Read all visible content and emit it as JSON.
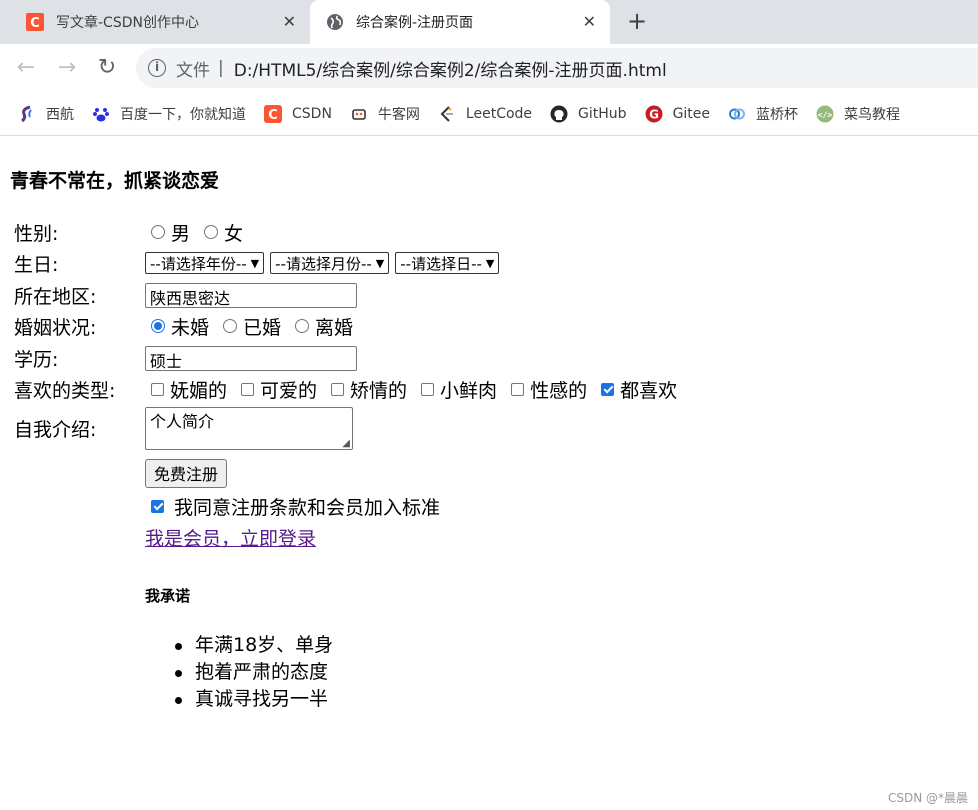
{
  "browser": {
    "tabs": [
      {
        "title": "写文章-CSDN创作中心",
        "icon": "csdn-icon"
      },
      {
        "title": "综合案例-注册页面",
        "icon": "globe-icon"
      }
    ],
    "new_tab": "+",
    "url_scheme": "文件",
    "url": "D:/HTML5/综合案例/综合案例2/综合案例-注册页面.html",
    "bookmarks": [
      {
        "label": "西航",
        "icon": "xihang-icon",
        "color": "#5b3a8e"
      },
      {
        "label": "百度一下，你就知道",
        "icon": "baidu-icon",
        "color": "#2932e1"
      },
      {
        "label": "CSDN",
        "icon": "csdn-icon",
        "color": "#fc5531"
      },
      {
        "label": "牛客网",
        "icon": "nowcoder-icon",
        "color": "#333333"
      },
      {
        "label": "LeetCode",
        "icon": "leetcode-icon",
        "color": "#ffa116"
      },
      {
        "label": "GitHub",
        "icon": "github-icon",
        "color": "#24292e"
      },
      {
        "label": "Gitee",
        "icon": "gitee-icon",
        "color": "#c71d23"
      },
      {
        "label": "蓝桥杯",
        "icon": "lanqiao-icon",
        "color": "#2a7fd4"
      },
      {
        "label": "菜鸟教程",
        "icon": "runoob-icon",
        "color": "#96b97d"
      }
    ]
  },
  "page": {
    "heading": "青春不常在，抓紧谈恋爱",
    "gender": {
      "label": "性别:",
      "options": [
        "男",
        "女"
      ]
    },
    "birthday": {
      "label": "生日:",
      "year": "--请选择年份--",
      "month": "--请选择月份--",
      "day": "--请选择日--"
    },
    "region": {
      "label": "所在地区:",
      "value": "陕西思密达"
    },
    "marital": {
      "label": "婚姻状况:",
      "options": [
        "未婚",
        "已婚",
        "离婚"
      ],
      "selected": "未婚"
    },
    "education": {
      "label": "学历:",
      "value": "硕士"
    },
    "types": {
      "label": "喜欢的类型:",
      "options": [
        "妩媚的",
        "可爱的",
        "矫情的",
        "小鲜肉",
        "性感的",
        "都喜欢"
      ],
      "checked": [
        "都喜欢"
      ]
    },
    "intro": {
      "label": "自我介绍:",
      "value": "个人简介"
    },
    "submit": "免费注册",
    "agree": "我同意注册条款和会员加入标准",
    "login_link": "我是会员，立即登录",
    "promise_heading": "我承诺",
    "promises": [
      "年满18岁、单身",
      "抱着严肃的态度",
      "真诚寻找另一半"
    ],
    "watermark": "CSDN @*晨晨"
  }
}
